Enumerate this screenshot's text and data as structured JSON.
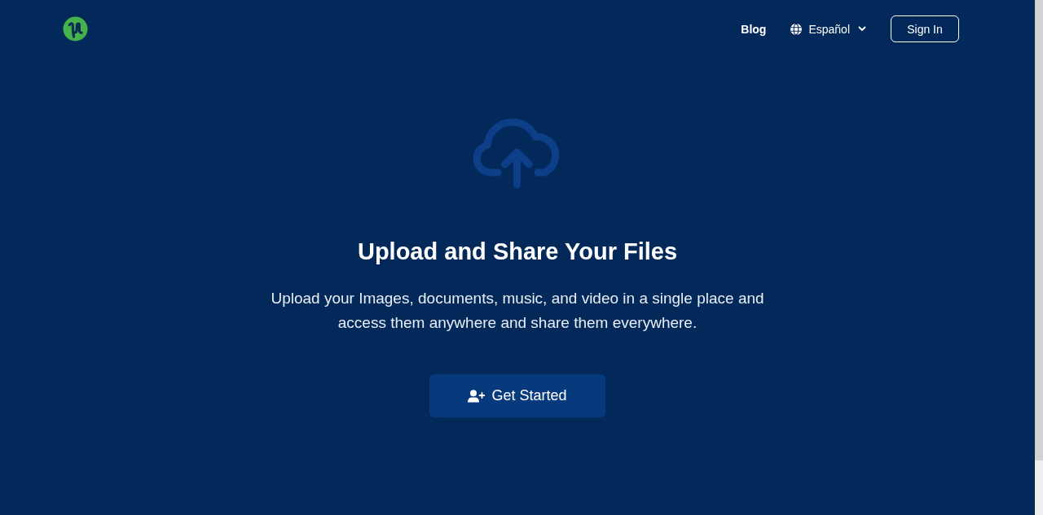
{
  "header": {
    "nav": [
      {
        "kind": "link",
        "label": "Blog"
      },
      {
        "kind": "language",
        "label": "Español"
      }
    ],
    "sign_in": "Sign In"
  },
  "hero": {
    "title": "Upload and Share Your Files",
    "subtitle": "Upload your Images, documents, music, and video in a single place and access them anywhere and share them everywhere.",
    "button": "Get Started"
  }
}
